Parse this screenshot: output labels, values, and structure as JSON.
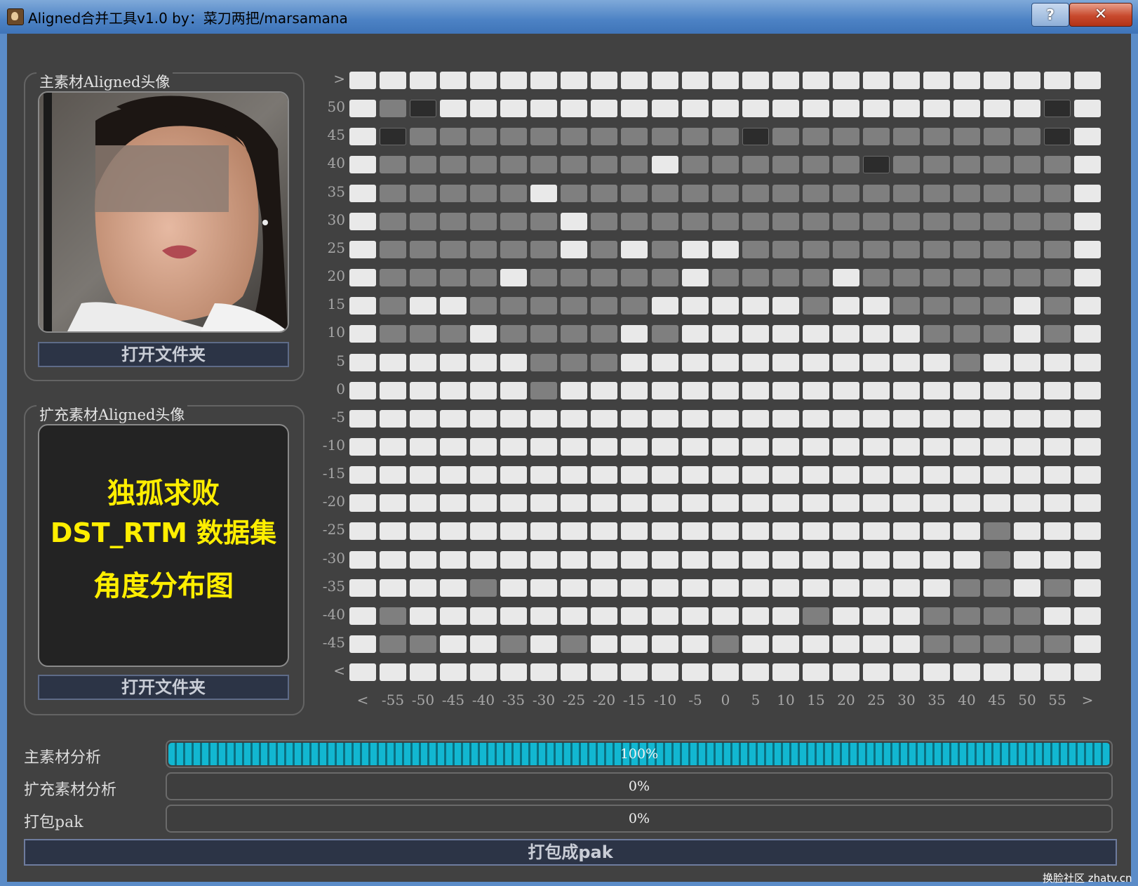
{
  "window": {
    "title": "Aligned合并工具v1.0  by：菜刀两把/marsamana",
    "help": "?",
    "close": "✕"
  },
  "main_group": {
    "label": "主素材Aligned头像",
    "open_button": "打开文件夹"
  },
  "ext_group": {
    "label": "扩充素材Aligned头像",
    "text_lines": [
      "独孤求败",
      "DST_RTM 数据集",
      "角度分布图"
    ],
    "open_button": "打开文件夹"
  },
  "grid": {
    "y_labels": [
      ">",
      "50",
      "45",
      "40",
      "35",
      "30",
      "25",
      "20",
      "15",
      "10",
      "5",
      "0",
      "-5",
      "-10",
      "-15",
      "-20",
      "-25",
      "-30",
      "-35",
      "-40",
      "-45",
      "<"
    ],
    "x_labels": [
      "<",
      "-55",
      "-50",
      "-45",
      "-40",
      "-35",
      "-30",
      "-25",
      "-20",
      "-15",
      "-10",
      "-5",
      "0",
      "5",
      "10",
      "15",
      "20",
      "25",
      "30",
      "35",
      "40",
      "45",
      "50",
      "55",
      ">"
    ],
    "rows": [
      "0000000000000000000000000",
      "0120000000000000000000020",
      "0211111111111211111111120",
      "0111111111011111121111110",
      "0111110111111111111111110",
      "0111111011111111111111110",
      "0111111010100111111111110",
      "0111101111101111011111110",
      "0100111111000001001111010",
      "0111011110100000000111010",
      "0000001110000000000010000",
      "0000001000000000000000000",
      "0000000000000000000000000",
      "0000000000000000000000000",
      "0000000000000000000000000",
      "0000000000000000000000000",
      "0000000000000000000001000",
      "0000000000000000000001000",
      "0000100000000000000011010",
      "0100000000000001000111100",
      "0110010100001000000111110",
      "0000000000000000000000000"
    ],
    "legend": {
      "0": "#e9e9e9",
      "1": "#7f7f7f",
      "2": "#2c2c2c"
    }
  },
  "progress": [
    {
      "label": "主素材分析",
      "value": 100,
      "text": "100%"
    },
    {
      "label": "扩充素材分析",
      "value": 0,
      "text": "0%"
    },
    {
      "label": "打包pak",
      "value": 0,
      "text": "0%"
    }
  ],
  "pack_button": "打包成pak",
  "watermark": "换脸社区 zhatv.cn",
  "colors": {
    "accent": "#12b7d1",
    "highlight_text": "#ffee00",
    "background": "#414141"
  }
}
